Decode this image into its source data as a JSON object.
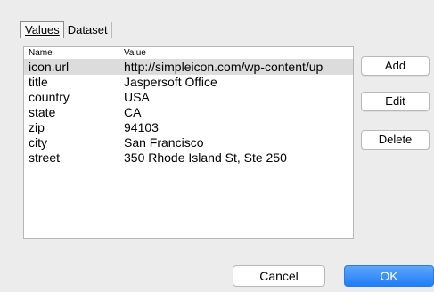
{
  "tabs": [
    {
      "label": "Values",
      "active": true
    },
    {
      "label": "Dataset",
      "active": false
    }
  ],
  "table": {
    "columns": [
      "Name",
      "Value"
    ],
    "rows": [
      {
        "name": "icon.url",
        "value": "http://simpleicon.com/wp-content/up",
        "selected": true
      },
      {
        "name": "title",
        "value": "Jaspersoft Office",
        "selected": false
      },
      {
        "name": "country",
        "value": "USA",
        "selected": false
      },
      {
        "name": "state",
        "value": "CA",
        "selected": false
      },
      {
        "name": "zip",
        "value": "94103",
        "selected": false
      },
      {
        "name": "city",
        "value": "San Francisco",
        "selected": false
      },
      {
        "name": "street",
        "value": "350 Rhode Island St, Ste 250",
        "selected": false
      }
    ]
  },
  "buttons": {
    "add": "Add",
    "edit": "Edit",
    "delete": "Delete",
    "cancel": "Cancel",
    "ok": "OK"
  },
  "colors": {
    "background": "#ececec",
    "selected_row": "#dcdcdc",
    "ok_accent": "#1f7ef6"
  }
}
